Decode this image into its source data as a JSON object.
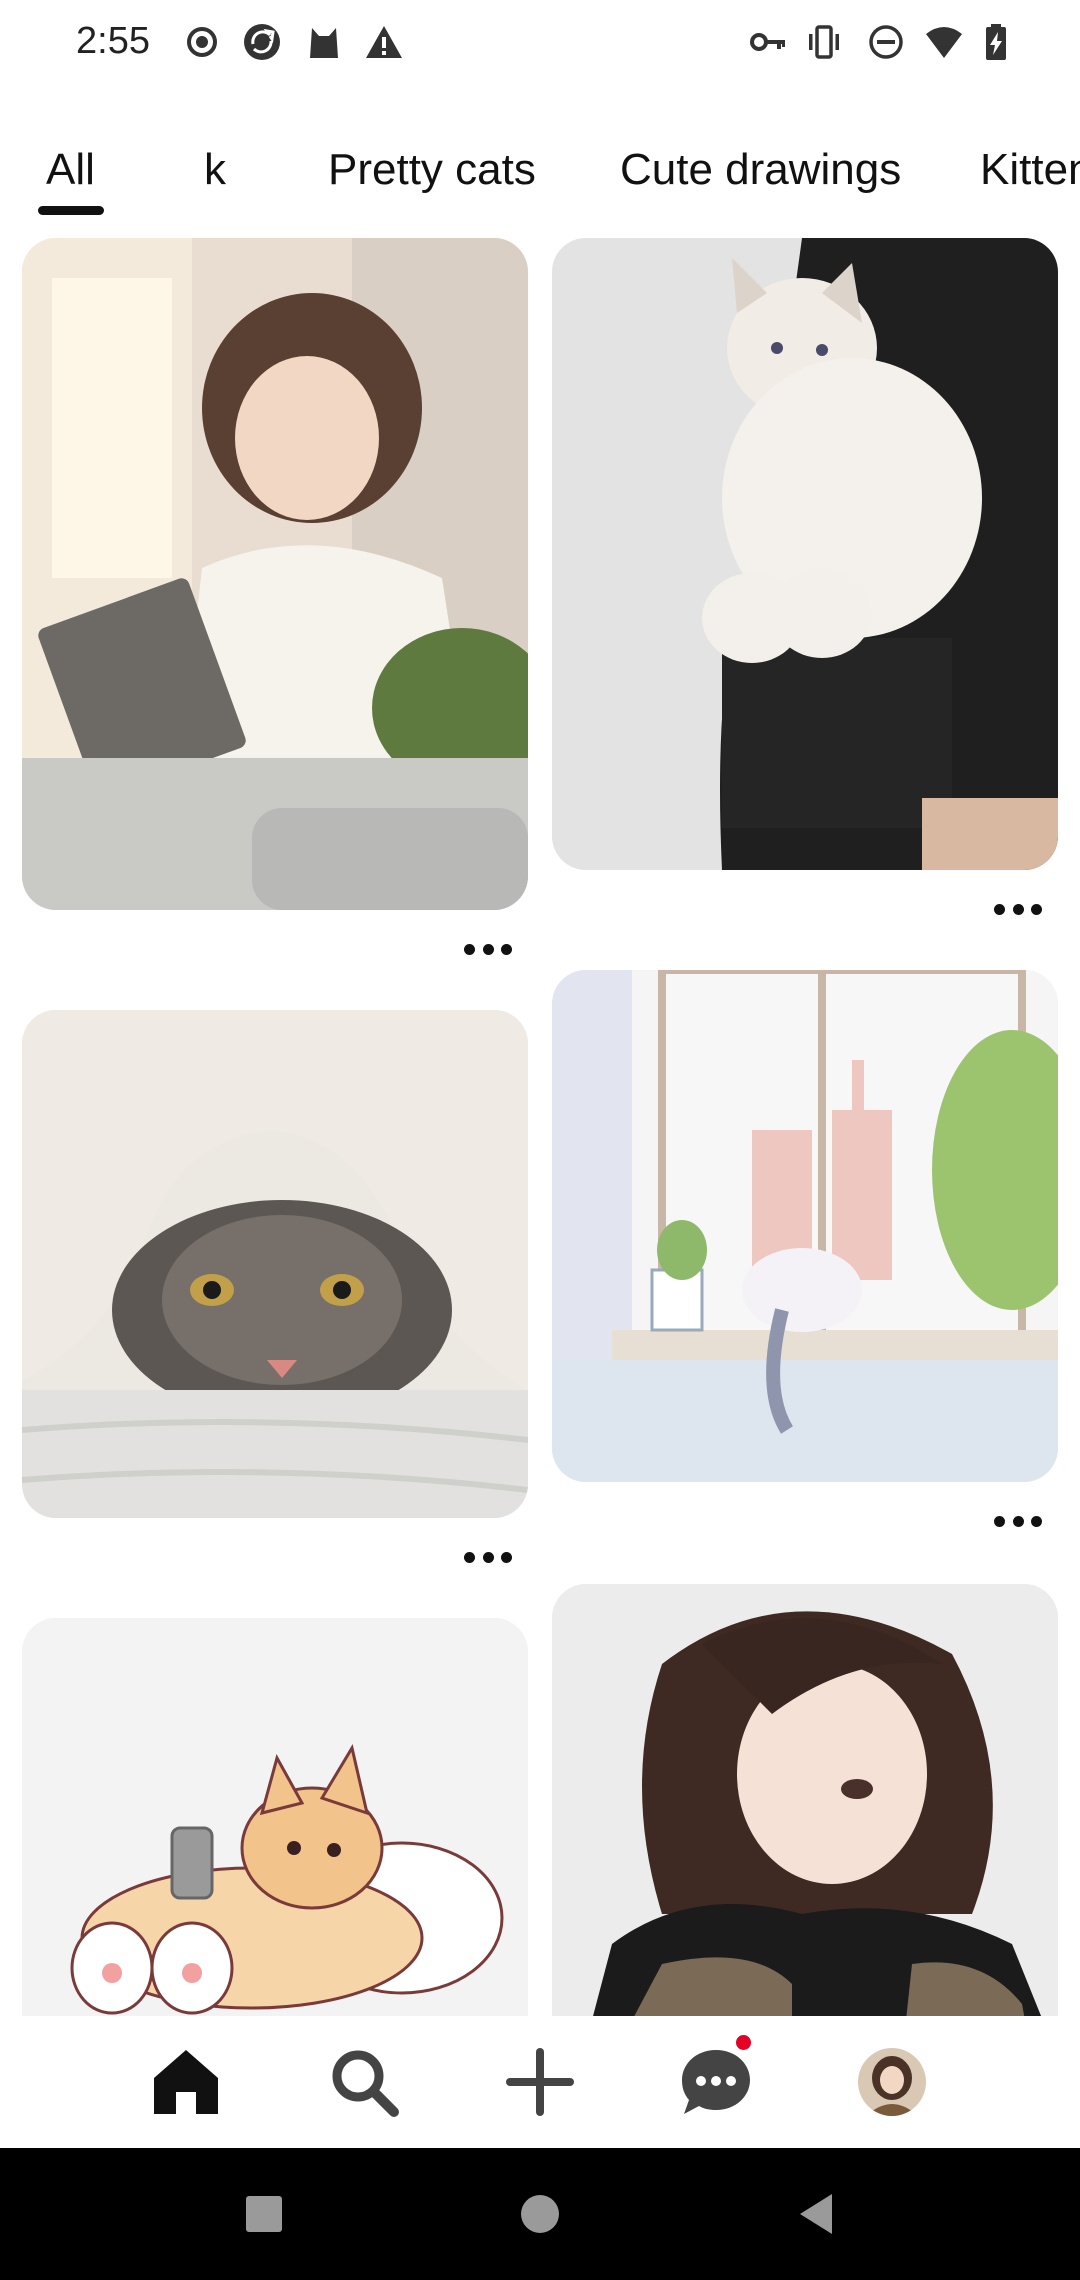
{
  "status_bar": {
    "time": "2:55",
    "left_icons": [
      "record-icon",
      "sync-icon",
      "cat-app-icon",
      "warning-icon"
    ],
    "right_icons": [
      "vpn-key-icon",
      "vibrate-icon",
      "do-not-disturb-icon",
      "wifi-icon",
      "battery-charging-icon"
    ]
  },
  "tabs": [
    {
      "label": "All",
      "selected": true
    },
    {
      "label": "k",
      "selected": false
    },
    {
      "label": "Pretty cats",
      "selected": false
    },
    {
      "label": "Cute drawings",
      "selected": false
    },
    {
      "label": "Kitten",
      "selected": false
    }
  ],
  "bottom_nav": {
    "items": [
      "home-icon",
      "search-icon",
      "create-icon",
      "messages-icon",
      "profile-avatar"
    ],
    "messages_has_notification": true
  },
  "colors": {
    "accent": "#111111",
    "notification": "#e60023"
  }
}
